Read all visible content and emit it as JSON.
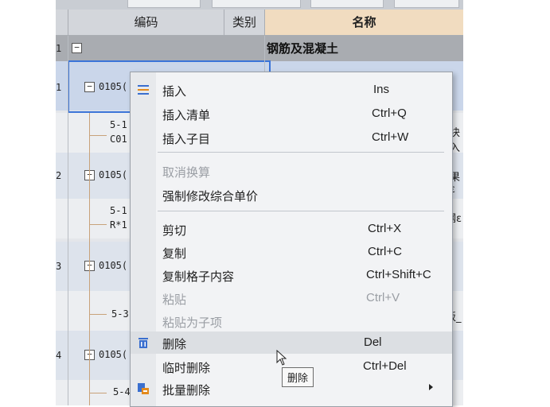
{
  "table": {
    "headers": {
      "code": "编码",
      "category": "类别",
      "name": "名称"
    },
    "group": {
      "row_number": "1",
      "expander": "−",
      "title": "钢筋及混凝土"
    },
    "rows": [
      {
        "row_number": "1",
        "code": "0105(",
        "sub_code_1": "5-1",
        "sub_code_2": "C01",
        "right_text": "块入"
      },
      {
        "row_number": "2",
        "code": "0105(",
        "sub_code_1": "5-1",
        "sub_code_2": "R*1",
        "right_text_1": "果ε",
        "right_text_2": "钢ε"
      },
      {
        "row_number": "3",
        "code": "0105(",
        "sub_code_1": "5-3",
        "right_text": "板_"
      },
      {
        "row_number": "4",
        "code": "0105(",
        "sub_code_1": "5-4"
      }
    ]
  },
  "context_menu": {
    "items": [
      {
        "label": "插入",
        "shortcut": "Ins",
        "icon": "insert-icon"
      },
      {
        "label": "插入清单",
        "shortcut": "Ctrl+Q"
      },
      {
        "label": "插入子目",
        "shortcut": "Ctrl+W"
      },
      {
        "label": "取消换算",
        "shortcut": "",
        "disabled": true
      },
      {
        "label": "强制修改综合单价",
        "shortcut": ""
      },
      {
        "label": "剪切",
        "shortcut": "Ctrl+X"
      },
      {
        "label": "复制",
        "shortcut": "Ctrl+C"
      },
      {
        "label": "复制格子内容",
        "shortcut": "Ctrl+Shift+C"
      },
      {
        "label": "粘贴",
        "shortcut": "Ctrl+V",
        "disabled": true
      },
      {
        "label": "粘贴为子项",
        "shortcut": "",
        "disabled": true
      },
      {
        "label": "删除",
        "shortcut": "Del",
        "icon": "trash-icon",
        "hovered": true
      },
      {
        "label": "临时删除",
        "shortcut": "Ctrl+Del"
      },
      {
        "label": "批量删除",
        "shortcut": "",
        "icon": "batch-delete-icon",
        "has_submenu": true
      }
    ]
  },
  "tooltip": {
    "text": "删除"
  },
  "colors": {
    "selection_border": "#3b74d8",
    "name_header_bg": "#f1dcc0",
    "group_row_bg": "#a9acb1",
    "menu_bg": "#f2f3f5",
    "hover_bg": "#dcdfe3"
  }
}
